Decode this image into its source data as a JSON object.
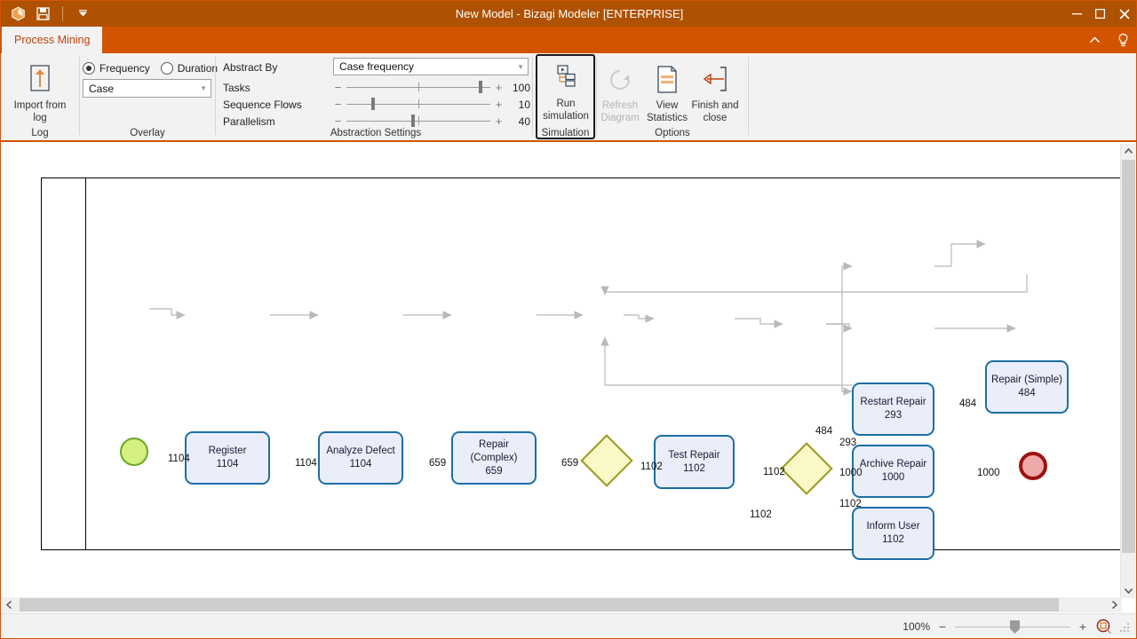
{
  "window": {
    "title": "New Model - Bizagi Modeler [ENTERPRISE]",
    "quick_access": {
      "app_icon": "bizagi-logo-icon",
      "save_icon": "save-icon",
      "customize_icon": "chevron-down-icon"
    },
    "controls": {
      "minimize": "–",
      "maximize": "☐",
      "close": "✕"
    }
  },
  "ribbon": {
    "tab_label": "Process Mining",
    "collapse_icon": "chevron-up-icon",
    "help_icon": "lightbulb-icon",
    "groups": {
      "log": {
        "label": "Log",
        "import_button": {
          "line1": "Import from",
          "line2": "log",
          "icon": "up-arrow-import-icon"
        }
      },
      "overlay": {
        "label": "Overlay",
        "radios": [
          {
            "label": "Frequency",
            "selected": true
          },
          {
            "label": "Duration",
            "selected": false
          }
        ],
        "dropdown_value": "Case"
      },
      "abstraction": {
        "label": "Abstraction Settings",
        "abstract_by_label": "Abstract By",
        "abstract_by_value": "Case frequency",
        "sliders": [
          {
            "label": "Tasks",
            "value": "100",
            "pct": 92
          },
          {
            "label": "Sequence Flows",
            "value": "10",
            "pct": 17
          },
          {
            "label": "Parallelism",
            "value": "40",
            "pct": 45
          }
        ]
      },
      "simulation": {
        "label": "Simulation",
        "run_button": {
          "line1": "Run",
          "line2": "simulation",
          "icon": "run-simulation-icon"
        }
      },
      "options": {
        "label": "Options",
        "buttons": [
          {
            "line1": "Refresh",
            "line2": "Diagram",
            "icon": "refresh-icon",
            "disabled": true
          },
          {
            "line1": "View",
            "line2": "Statistics",
            "icon": "document-stats-icon",
            "disabled": false
          },
          {
            "line1": "Finish and",
            "line2": "close",
            "icon": "back-arrow-icon",
            "disabled": false
          }
        ]
      }
    }
  },
  "diagram": {
    "nodes": [
      {
        "id": "start",
        "kind": "start-event",
        "label": "",
        "count": ""
      },
      {
        "id": "register",
        "kind": "task",
        "label": "Register",
        "count": "1104"
      },
      {
        "id": "analyze",
        "kind": "task",
        "label": "Analyze Defect",
        "count": "1104"
      },
      {
        "id": "repairc",
        "kind": "task",
        "label": "Repair (Complex)",
        "count": "659"
      },
      {
        "id": "gw1",
        "kind": "gateway",
        "label": "",
        "count": ""
      },
      {
        "id": "test",
        "kind": "task",
        "label": "Test Repair",
        "count": "1102"
      },
      {
        "id": "gw2",
        "kind": "gateway",
        "label": "",
        "count": ""
      },
      {
        "id": "restart",
        "kind": "task",
        "label": "Restart Repair",
        "count": "293"
      },
      {
        "id": "repairs",
        "kind": "task",
        "label": "Repair (Simple)",
        "count": "484"
      },
      {
        "id": "archive",
        "kind": "task",
        "label": "Archive Repair",
        "count": "1000"
      },
      {
        "id": "inform",
        "kind": "task",
        "label": "Inform User",
        "count": "1102"
      },
      {
        "id": "end",
        "kind": "end-event",
        "label": "",
        "count": ""
      }
    ],
    "edge_labels": [
      "1104",
      "1104",
      "659",
      "659",
      "1102",
      "1102",
      "484",
      "293",
      "1000",
      "1102",
      "484",
      "1000",
      "1102"
    ]
  },
  "statusbar": {
    "zoom_percent": "100%",
    "zoom_out_icon": "minus-icon",
    "zoom_in_icon": "plus-icon",
    "fit_icon": "zoom-fit-icon"
  }
}
